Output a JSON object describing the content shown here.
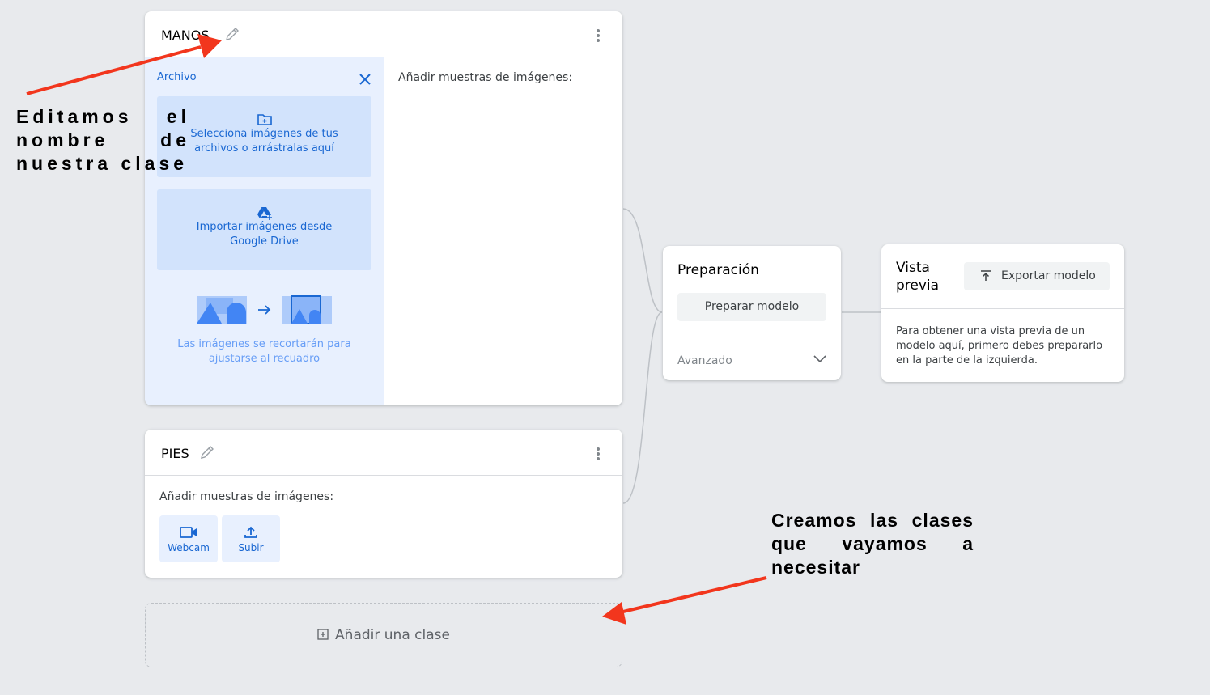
{
  "class1": {
    "name": "MANOS",
    "upload_panel": {
      "title": "Archivo",
      "select_files": "Selecciona imágenes de tus archivos o arrástralas aquí",
      "drive_import": "Importar imágenes desde Google Drive",
      "crop_note": "Las imágenes se recortarán para ajustarse al recuadro"
    },
    "samples_label": "Añadir muestras de imágenes:"
  },
  "class2": {
    "name": "PIES",
    "samples_label": "Añadir muestras de imágenes:",
    "webcam_label": "Webcam",
    "upload_label": "Subir"
  },
  "add_class": {
    "label": "Añadir una clase"
  },
  "training": {
    "title": "Preparación",
    "train_button": "Preparar modelo",
    "advanced_label": "Avanzado"
  },
  "preview": {
    "title": "Vista previa",
    "export_button": "Exportar modelo",
    "message": "Para obtener una vista previa de un modelo aquí, primero debes prepararlo en la parte de la izquierda."
  },
  "annotations": {
    "edit_name": "Editamos el nombre de nuestra clase",
    "create_classes": "Creamos las clases que vayamos a necesitar"
  },
  "colors": {
    "accent": "#1967d2",
    "arrow": "#f2361d",
    "tile_bg": "#d2e3fc",
    "panel_bg": "#e8f0fe"
  }
}
